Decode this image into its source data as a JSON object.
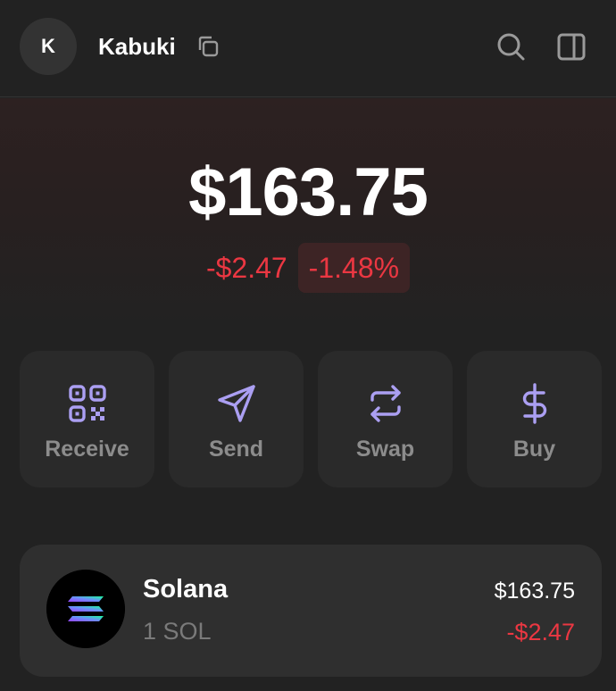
{
  "header": {
    "avatar_initial": "K",
    "account_name": "Kabuki"
  },
  "portfolio": {
    "balance": "$163.75",
    "change_value": "-$2.47",
    "change_percent": "-1.48%"
  },
  "actions": [
    {
      "label": "Receive",
      "icon": "qr-code-icon"
    },
    {
      "label": "Send",
      "icon": "send-arrow-icon"
    },
    {
      "label": "Swap",
      "icon": "swap-icon"
    },
    {
      "label": "Buy",
      "icon": "dollar-icon"
    }
  ],
  "tokens": [
    {
      "name": "Solana",
      "amount": "1 SOL",
      "value": "$163.75",
      "change": "-$2.47",
      "icon": "solana-logo-icon"
    }
  ],
  "colors": {
    "background": "#222222",
    "accent": "#ab9ff2",
    "negative": "#eb3742",
    "card": "#2a2a2a"
  }
}
